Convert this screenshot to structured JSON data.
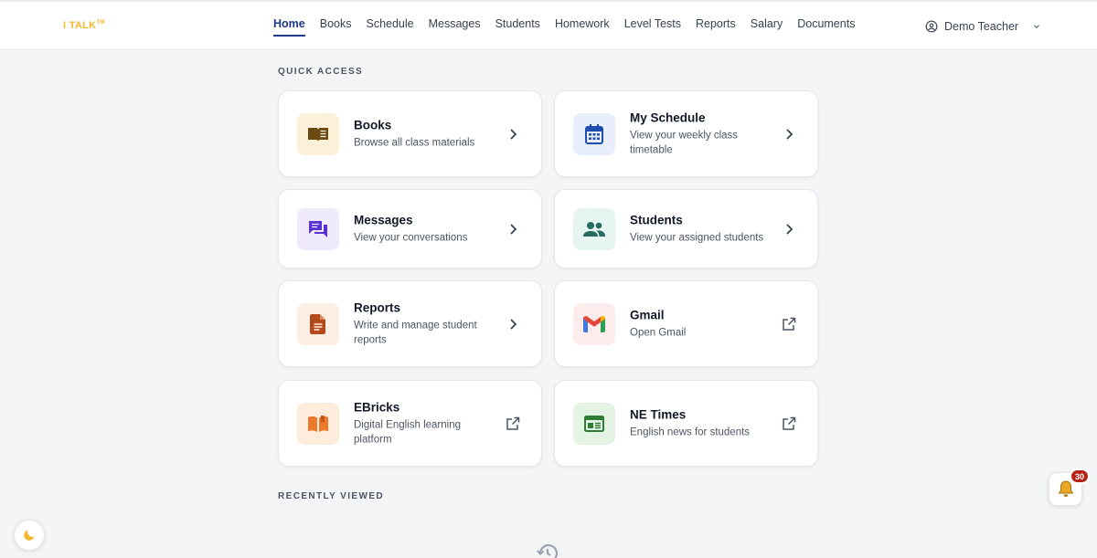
{
  "app": {
    "logo": "I TALK",
    "logo_tm": "TM"
  },
  "nav": {
    "items": [
      {
        "label": "Home",
        "active": true
      },
      {
        "label": "Books"
      },
      {
        "label": "Schedule"
      },
      {
        "label": "Messages"
      },
      {
        "label": "Students"
      },
      {
        "label": "Homework"
      },
      {
        "label": "Level Tests"
      },
      {
        "label": "Reports"
      },
      {
        "label": "Salary"
      },
      {
        "label": "Documents"
      }
    ]
  },
  "user": {
    "name": "Demo Teacher"
  },
  "quick_access": {
    "title": "QUICK ACCESS",
    "cards": [
      {
        "title": "Books",
        "desc": "Browse all class materials",
        "icon": "book-open-icon",
        "action": "chevron"
      },
      {
        "title": "My Schedule",
        "desc": "View your weekly class timetable",
        "icon": "calendar-icon",
        "action": "chevron"
      },
      {
        "title": "Messages",
        "desc": "View your conversations",
        "icon": "chat-bubbles-icon",
        "action": "chevron"
      },
      {
        "title": "Students",
        "desc": "View your assigned students",
        "icon": "people-icon",
        "action": "chevron"
      },
      {
        "title": "Reports",
        "desc": "Write and manage student reports",
        "icon": "document-icon",
        "action": "chevron"
      },
      {
        "title": "Gmail",
        "desc": "Open Gmail",
        "icon": "gmail-icon",
        "action": "external"
      },
      {
        "title": "EBricks",
        "desc": "Digital English learning platform",
        "icon": "open-book-icon",
        "action": "external"
      },
      {
        "title": "NE Times",
        "desc": "English news for students",
        "icon": "newspaper-icon",
        "action": "external"
      }
    ]
  },
  "recently_viewed": {
    "title": "RECENTLY VIEWED"
  },
  "notifications": {
    "count": "30"
  },
  "colors": {
    "nav_active": "#1e3a8a",
    "logo": "#f5b82e",
    "badge": "#b42318"
  }
}
